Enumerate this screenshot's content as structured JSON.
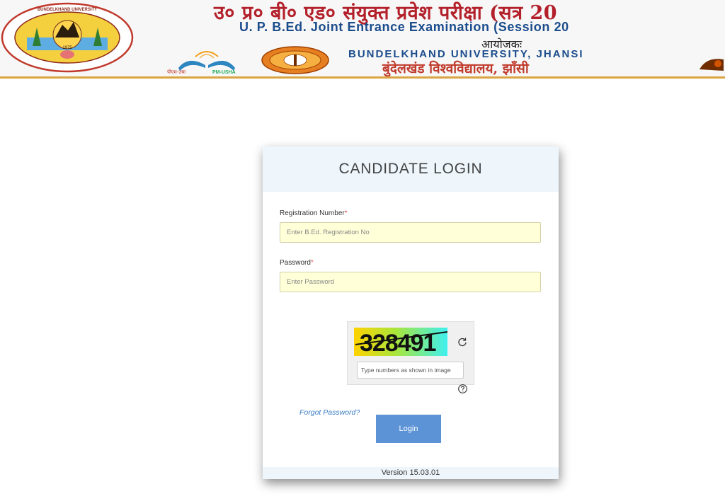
{
  "banner": {
    "title_hindi": "उ० प्र० बी० एड० संयुक्त प्रवेश परीक्षा (सत्र 20",
    "title_english": "U. P. B.Ed. Joint Entrance Examination (Session 20",
    "organiser_label": "आयोजकः",
    "university_english": "BUNDELKHAND UNIVERSITY, JHANSI",
    "university_hindi": "बुंदेलखंड विश्वविद्यालय, झाँसी",
    "logo_text": "BUNDELKHAND UNIVERSITY",
    "logo_year": "1975",
    "pmusha_text": "PM-USHA",
    "pmusha_hindi": "पीएम-उषा"
  },
  "login": {
    "title": "CANDIDATE LOGIN",
    "registration_label": "Registration Number",
    "registration_placeholder": "Enter B.Ed. Registration No",
    "password_label": "Password",
    "password_placeholder": "Enter Password",
    "required_mark": "*",
    "captcha_value": "328491",
    "captcha_placeholder": "Type numbers as shown in image",
    "forgot_password": "Forgot Password?",
    "login_button": "Login",
    "version": "Version 15.03.01"
  },
  "colors": {
    "banner_title": "#b3202a",
    "banner_english": "#1b4c8c",
    "input_background": "#ffffd8",
    "button": "#5b93d6",
    "link": "#3a7cc5",
    "header_background": "#eef6fc"
  },
  "icons": {
    "refresh": "refresh-icon",
    "help": "help-icon"
  }
}
